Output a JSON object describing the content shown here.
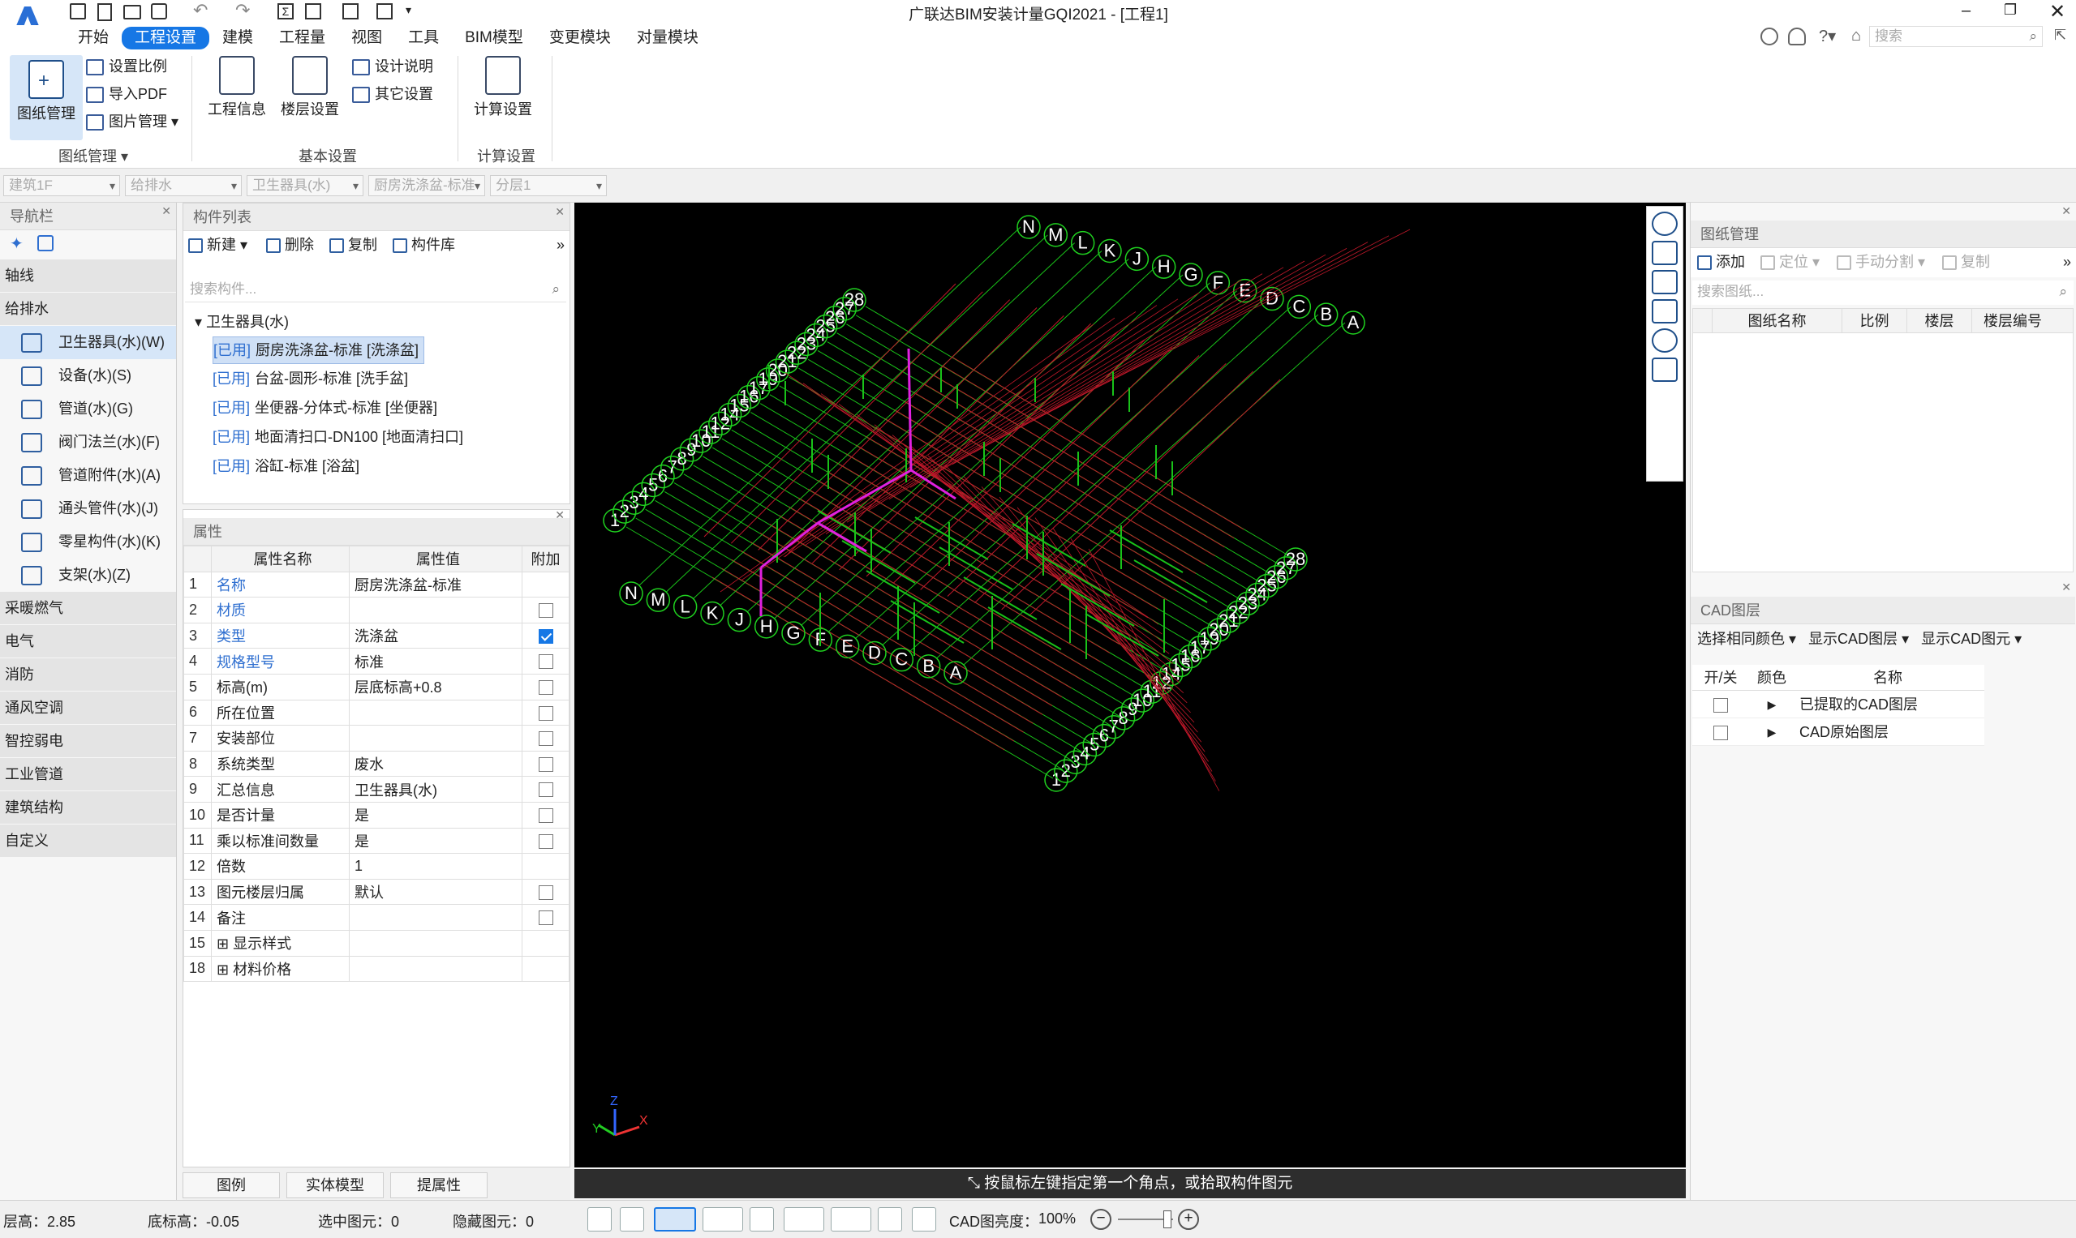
{
  "app": {
    "title": "广联达BIM安装计量GQI2021 - [工程1]",
    "search_placeholder": "搜索"
  },
  "menu": [
    "开始",
    "工程设置",
    "建模",
    "工程量",
    "视图",
    "工具",
    "BIM模型",
    "变更模块",
    "对量模块"
  ],
  "ribbon": {
    "drawing_mgmt": "图纸管理",
    "set_scale": "设置比例",
    "import_pdf": "导入PDF",
    "image_mgmt": "图片管理",
    "group_drawing": "图纸管理",
    "project_info": "工程信息",
    "floor_settings": "楼层设置",
    "design_notes": "设计说明",
    "other_settings": "其它设置",
    "group_basic": "基本设置",
    "calc_settings": "计算设置",
    "group_calc": "计算设置"
  },
  "filters": [
    "建筑1F",
    "给排水",
    "卫生器具(水)",
    "厨房洗涤盆-标准",
    "分层1"
  ],
  "nav": {
    "title": "导航栏",
    "items": [
      {
        "label": "轴线",
        "type": "cat"
      },
      {
        "label": "给排水",
        "type": "cat"
      },
      {
        "label": "卫生器具(水)(W)",
        "type": "sub",
        "selected": true
      },
      {
        "label": "设备(水)(S)",
        "type": "sub"
      },
      {
        "label": "管道(水)(G)",
        "type": "sub"
      },
      {
        "label": "阀门法兰(水)(F)",
        "type": "sub"
      },
      {
        "label": "管道附件(水)(A)",
        "type": "sub"
      },
      {
        "label": "通头管件(水)(J)",
        "type": "sub"
      },
      {
        "label": "零星构件(水)(K)",
        "type": "sub"
      },
      {
        "label": "支架(水)(Z)",
        "type": "sub"
      },
      {
        "label": "采暖燃气",
        "type": "cat"
      },
      {
        "label": "电气",
        "type": "cat"
      },
      {
        "label": "消防",
        "type": "cat"
      },
      {
        "label": "通风空调",
        "type": "cat"
      },
      {
        "label": "智控弱电",
        "type": "cat"
      },
      {
        "label": "工业管道",
        "type": "cat"
      },
      {
        "label": "建筑结构",
        "type": "cat"
      },
      {
        "label": "自定义",
        "type": "cat"
      }
    ]
  },
  "components": {
    "title": "构件列表",
    "new": "新建",
    "delete": "删除",
    "copy": "复制",
    "library": "构件库",
    "search_placeholder": "搜索构件...",
    "group": "卫生器具(水)",
    "items": [
      {
        "tag": "[已用]",
        "name": "厨房洗涤盆-标准 [洗涤盆]"
      },
      {
        "tag": "[已用]",
        "name": "台盆-圆形-标准 [洗手盆]"
      },
      {
        "tag": "[已用]",
        "name": "坐便器-分体式-标准 [坐便器]"
      },
      {
        "tag": "[已用]",
        "name": "地面清扫口-DN100 [地面清扫口]"
      },
      {
        "tag": "[已用]",
        "name": "浴缸-标准 [浴盆]"
      }
    ]
  },
  "properties": {
    "title": "属性",
    "headers": [
      "属性名称",
      "属性值",
      "附加"
    ],
    "rows": [
      {
        "n": "1",
        "name": "名称",
        "value": "厨房洗涤盆-标准",
        "blue": true,
        "cb": null
      },
      {
        "n": "2",
        "name": "材质",
        "value": "",
        "blue": true,
        "cb": false
      },
      {
        "n": "3",
        "name": "类型",
        "value": "洗涤盆",
        "blue": true,
        "cb": true
      },
      {
        "n": "4",
        "name": "规格型号",
        "value": "标准",
        "blue": true,
        "cb": false
      },
      {
        "n": "5",
        "name": "标高(m)",
        "value": "层底标高+0.8",
        "blue": false,
        "cb": false
      },
      {
        "n": "6",
        "name": "所在位置",
        "value": "",
        "blue": false,
        "cb": false
      },
      {
        "n": "7",
        "name": "安装部位",
        "value": "",
        "blue": false,
        "cb": false
      },
      {
        "n": "8",
        "name": "系统类型",
        "value": "废水",
        "blue": false,
        "cb": false
      },
      {
        "n": "9",
        "name": "汇总信息",
        "value": "卫生器具(水)",
        "blue": false,
        "cb": false
      },
      {
        "n": "10",
        "name": "是否计量",
        "value": "是",
        "blue": false,
        "cb": false
      },
      {
        "n": "11",
        "name": "乘以标准间数量",
        "value": "是",
        "blue": false,
        "cb": false
      },
      {
        "n": "12",
        "name": "倍数",
        "value": "1",
        "blue": false,
        "cb": null
      },
      {
        "n": "13",
        "name": "图元楼层归属",
        "value": "默认",
        "blue": false,
        "cb": false
      },
      {
        "n": "14",
        "name": "备注",
        "value": "",
        "blue": false,
        "cb": false
      },
      {
        "n": "15",
        "name": "显示样式",
        "value": "",
        "blue": false,
        "cb": null,
        "exp": true
      },
      {
        "n": "18",
        "name": "材料价格",
        "value": "",
        "blue": false,
        "cb": null,
        "exp": true
      }
    ]
  },
  "bottom_tabs": [
    "图例",
    "实体模型",
    "提属性"
  ],
  "canvas": {
    "prompt": "按鼠标左键指定第一个角点，或拾取构件图元",
    "axis_x": "X",
    "axis_y": "Y",
    "axis_z": "Z",
    "top_row": [
      "1",
      "2",
      "3",
      "4",
      "5",
      "6",
      "7",
      "8",
      "9",
      "10",
      "11",
      "12",
      "14",
      "15",
      "16",
      "17",
      "19",
      "20",
      "21",
      "22",
      "23",
      "24",
      "25",
      "26",
      "27",
      "28"
    ],
    "letters": [
      "N",
      "M",
      "L",
      "K",
      "J",
      "H",
      "G",
      "F",
      "E",
      "D",
      "C",
      "B",
      "A"
    ]
  },
  "drawing_panel": {
    "title": "图纸管理",
    "add": "添加",
    "locate": "定位",
    "manual_split": "手动分割",
    "copy": "复制",
    "search_placeholder": "搜索图纸...",
    "headers": [
      "图纸名称",
      "比例",
      "楼层",
      "楼层编号"
    ]
  },
  "cad_panel": {
    "title": "CAD图层",
    "same_color": "选择相同颜色",
    "show_layers": "显示CAD图层",
    "show_elements": "显示CAD图元",
    "headers": [
      "开/关",
      "颜色",
      "名称"
    ],
    "rows": [
      "已提取的CAD图层",
      "CAD原始图层"
    ]
  },
  "status": {
    "floor_height": "层高：2.85",
    "base_elev": "底标高：-0.05",
    "selected": "选中图元：0",
    "hidden": "隐藏图元：0",
    "brightness_label": "CAD图亮度：",
    "brightness": "100%"
  },
  "colors": {
    "accent": "#1677e5",
    "grid_red": "#c0182a",
    "grid_green": "#19c219",
    "pipe_magenta": "#e020e0"
  }
}
